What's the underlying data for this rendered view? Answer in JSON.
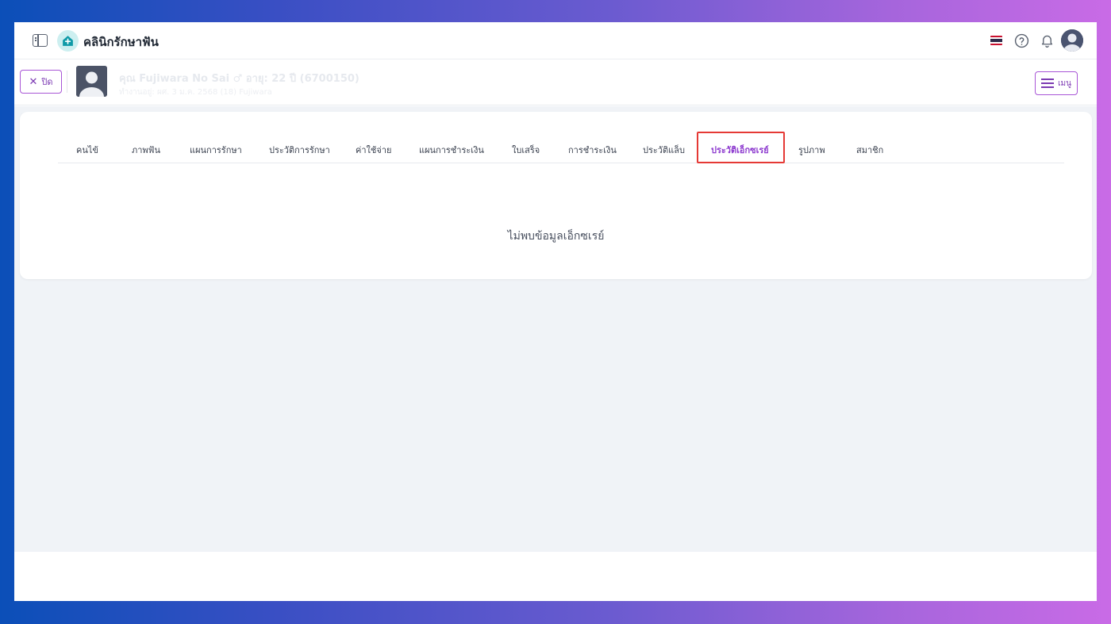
{
  "header": {
    "app_title": "คลินิกรักษาฟัน",
    "icons": [
      "sidebar-toggle-icon",
      "clinic-logo-icon",
      "thai-flag-icon",
      "help-icon",
      "bell-icon",
      "user-avatar"
    ]
  },
  "patient_bar": {
    "close_label": "ปิด",
    "name": "คุณ Fujiwara No Sai ♂ อายุ: 22 ปี (6700150)",
    "subtitle": "ทำงานอยู่: ผศ. 3 ม.ค. 2568 (18) Fujiwara",
    "menu_label": "เมนู"
  },
  "tabs": [
    {
      "label": "คนไข้"
    },
    {
      "label": "ภาพฟัน"
    },
    {
      "label": "แผนการรักษา"
    },
    {
      "label": "ประวัติการรักษา"
    },
    {
      "label": "ค่าใช้จ่าย"
    },
    {
      "label": "แผนการชำระเงิน"
    },
    {
      "label": "ใบเสร็จ"
    },
    {
      "label": "การชำระเงิน"
    },
    {
      "label": "ประวัติแล็บ"
    },
    {
      "label": "ประวัติเอ็กซเรย์",
      "active": true
    },
    {
      "label": "รูปภาพ"
    },
    {
      "label": "สมาชิก"
    }
  ],
  "main": {
    "empty_message": "ไม่พบข้อมูลเอ็กซเรย์"
  },
  "colors": {
    "accent": "#8e3ccf",
    "highlight_box": "#e53935",
    "content_bg": "#f0f3f7"
  }
}
